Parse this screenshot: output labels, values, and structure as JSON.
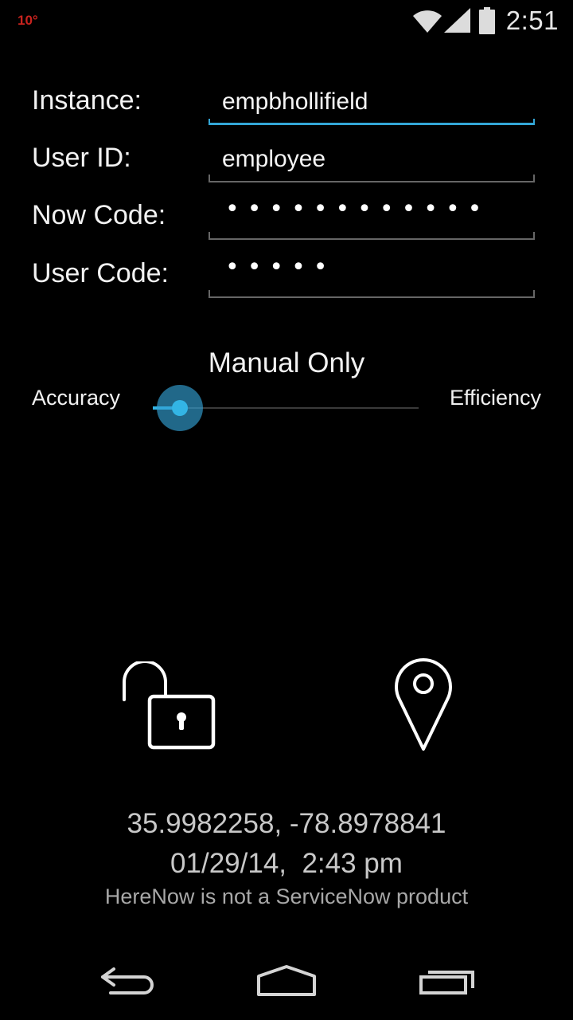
{
  "status_bar": {
    "temperature": "10°",
    "time": "2:51",
    "icons": [
      "wifi-icon",
      "signal-icon",
      "battery-icon"
    ]
  },
  "form": {
    "instance": {
      "label": "Instance:",
      "value": "empbhollifield"
    },
    "user_id": {
      "label": "User ID:",
      "value": "employee"
    },
    "now_code": {
      "label": "Now Code:",
      "masked_value": "••••••••••••"
    },
    "user_code": {
      "label": "User Code:",
      "masked_value": "•••••"
    }
  },
  "slider": {
    "mode_title": "Manual Only",
    "left_label": "Accuracy",
    "right_label": "Efficiency",
    "value": 0.05
  },
  "icons": {
    "lock": "unlock-icon",
    "location": "location-pin-icon"
  },
  "info": {
    "coordinates": "35.9982258, -78.8978841",
    "datetime": "01/29/14,  2:43 pm",
    "disclaimer": "HereNow is not a ServiceNow product"
  },
  "nav": {
    "buttons": [
      "back-icon",
      "home-icon",
      "recents-icon"
    ]
  },
  "colors": {
    "accent": "#33b5e5",
    "temperature": "#c8231e",
    "background": "#000000"
  }
}
